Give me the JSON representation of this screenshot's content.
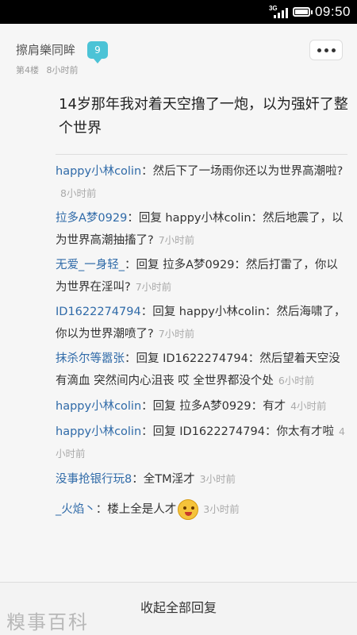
{
  "status_bar": {
    "network": "3G",
    "time": "09:50"
  },
  "post": {
    "username": "擦肩樂同眸",
    "level": "9",
    "floor": "第4楼",
    "time_ago": "8小时前",
    "content": "14岁那年我对着天空撸了一炮，以为强奸了整个世界",
    "more_icon": "more-icon"
  },
  "replies": [
    {
      "user": "happy小林colin",
      "sep": "：",
      "text": "然后下了一场雨你还以为世界高潮啦?",
      "time": "8小时前"
    },
    {
      "user": "拉多A梦0929",
      "sep": "：",
      "text": "回复 happy小林colin：然后地震了，以为世界高潮抽搐了?",
      "time": "7小时前"
    },
    {
      "user": "无爱_一身轻_",
      "sep": "：",
      "text": "回复 拉多A梦0929：然后打雷了，你以为世界在淫叫?",
      "time": "7小时前"
    },
    {
      "user": "ID1622274794",
      "sep": "：",
      "text": "回复 happy小林colin：然后海啸了，你以为世界潮喷了?",
      "time": "7小时前"
    },
    {
      "user": "抹杀尔等嚣张",
      "sep": "：",
      "text": "回复 ID1622274794：然后望着天空没有滴血 突然间内心沮丧 哎 全世界都没个处",
      "time": "6小时前"
    },
    {
      "user": "happy小林colin",
      "sep": "：",
      "text": "回复 拉多A梦0929：有才",
      "time": "4小时前"
    },
    {
      "user": "happy小林colin",
      "sep": "：",
      "text": "回复 ID1622274794：你太有才啦",
      "time": "4小时前"
    },
    {
      "user": "没事抢银行玩8",
      "sep": "：",
      "text": "全TM淫才",
      "time": "3小时前"
    },
    {
      "user": "_火焰丶",
      "sep": "：",
      "text": "楼上全是人才",
      "time": "3小时前",
      "emoji": "grinning-face-icon"
    }
  ],
  "footer": {
    "collapse_label": "收起全部回复",
    "watermark": "糗事百科"
  }
}
